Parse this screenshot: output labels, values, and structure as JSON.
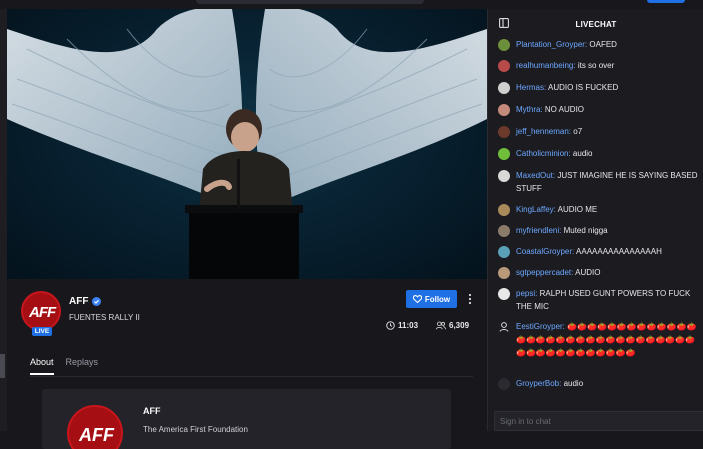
{
  "channel": {
    "name": "AFF",
    "stream_title": "FUENTES RALLY II",
    "live_label": "LIVE",
    "follow_label": "Follow",
    "elapsed_time": "11:03",
    "viewer_count": "6,309",
    "avatar_text": "AFF"
  },
  "tabs": [
    {
      "label": "About",
      "active": true
    },
    {
      "label": "Replays",
      "active": false
    }
  ],
  "about": {
    "name": "AFF",
    "description": "The America First Foundation"
  },
  "chat": {
    "title": "LIVECHAT",
    "input_placeholder": "Sign in to chat",
    "messages": [
      {
        "user": "Plantation_Groyper:",
        "text": " OAFED",
        "avatar_color": "#6b8f3a"
      },
      {
        "user": "realhumanbeing:",
        "text": " its so over",
        "avatar_color": "#b84a4a"
      },
      {
        "user": "Hermas:",
        "text": " AUDIO IS FUCKED",
        "avatar_color": "#cfcfcf"
      },
      {
        "user": "Mythra:",
        "text": " NO AUDIO",
        "avatar_color": "#c48a7a"
      },
      {
        "user": "jeff_henneman:",
        "text": " o7",
        "avatar_color": "#6b3a2a"
      },
      {
        "user": "Catholicminion:",
        "text": " audio",
        "avatar_color": "#6fbf3a"
      },
      {
        "user": "MaxedOut:",
        "text": " JUST IMAGINE HE IS SAYING BASED STUFF",
        "avatar_color": "#d8d8d8"
      },
      {
        "user": "KingLaffey:",
        "text": " AUDIO ME",
        "avatar_color": "#a88a5a"
      },
      {
        "user": "myfriendleni:",
        "text": " Muted nigga",
        "avatar_color": "#8a7a6a"
      },
      {
        "user": "CoastalGroyper:",
        "text": " AAAAAAAAAAAAAAAH",
        "avatar_color": "#5aa0b8"
      },
      {
        "user": "sgtpeppercadet:",
        "text": " AUDIO",
        "avatar_color": "#b89a7a"
      },
      {
        "user": "pepsi:",
        "text": " RALPH USED GUNT POWERS TO FUCK THE MIC",
        "avatar_color": "#e8e8e8"
      },
      {
        "user": "EestiGroyper:",
        "text": " 🍅🍅🍅🍅🍅🍅🍅🍅🍅🍅🍅🍅🍅🍅🍅🍅🍅🍅🍅🍅🍅🍅🍅🍅🍅🍅🍅🍅🍅🍅🍅🍅🍅🍅🍅🍅🍅🍅🍅🍅🍅🍅🍅",
        "avatar_color": "#1b1b20"
      },
      {
        "user": "GroyperBob:",
        "text": " audio",
        "avatar_color": "#2a2a31"
      }
    ]
  },
  "colors": {
    "accent": "#1f6fe5",
    "username": "#6ea8ff",
    "brand_red": "#a50f14"
  },
  "icons": [
    "collapse-chat-icon",
    "verified-icon",
    "heart-icon",
    "kebab-menu-icon",
    "clock-icon",
    "viewers-icon"
  ]
}
